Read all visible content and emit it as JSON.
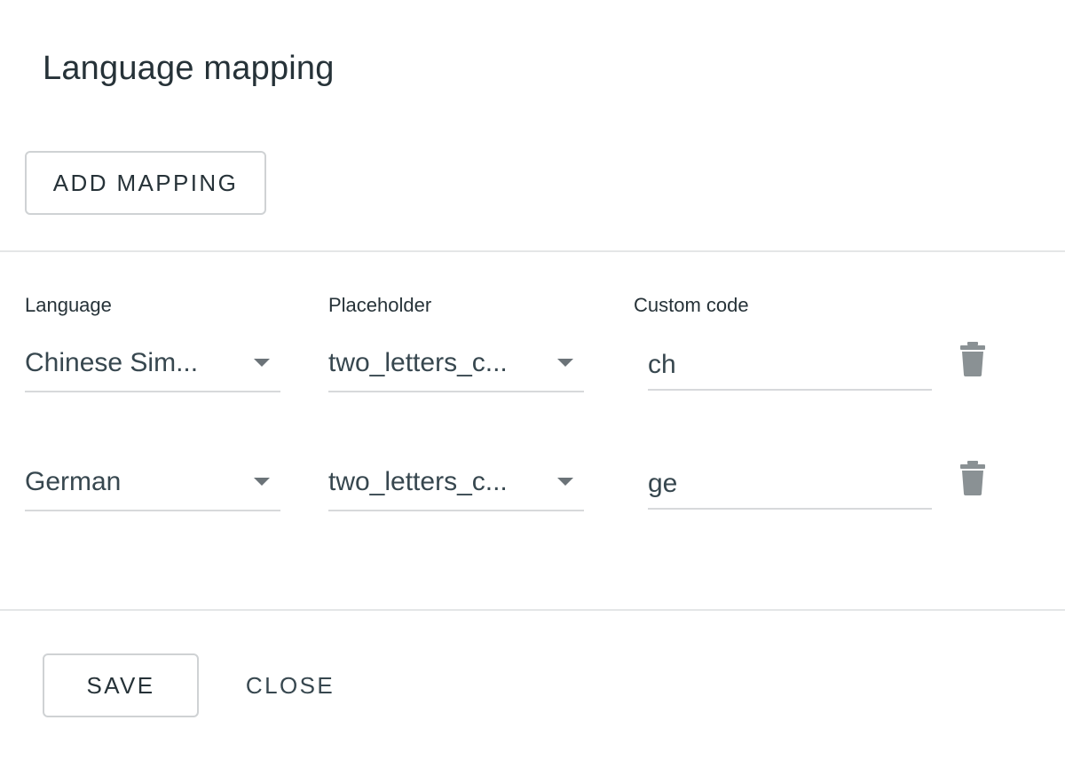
{
  "dialog": {
    "title": "Language mapping",
    "add_button_label": "ADD MAPPING"
  },
  "columns": {
    "language": "Language",
    "placeholder": "Placeholder",
    "custom_code": "Custom code"
  },
  "rows": [
    {
      "language": "Chinese Sim...",
      "placeholder": "two_letters_c...",
      "custom_code": "ch",
      "delete_icon": "trash-icon"
    },
    {
      "language": "German",
      "placeholder": "two_letters_c...",
      "custom_code": "ge",
      "delete_icon": "trash-icon"
    }
  ],
  "footer": {
    "save_label": "SAVE",
    "close_label": "CLOSE"
  },
  "colors": {
    "text": "#263238",
    "border": "#cfd2d4",
    "icon": "#8a9194"
  }
}
